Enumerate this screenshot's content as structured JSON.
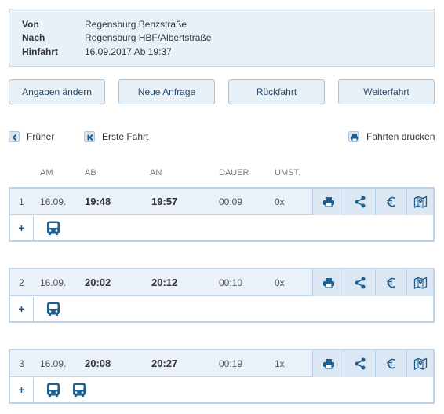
{
  "summary": {
    "from_label": "Von",
    "from_value": "Regensburg Benzstraße",
    "to_label": "Nach",
    "to_value": "Regensburg HBF/Albertstraße",
    "outbound_label": "Hinfahrt",
    "outbound_value": "16.09.2017 Ab 19:37"
  },
  "buttons": {
    "edit": "Angaben ändern",
    "new_query": "Neue Anfrage",
    "return": "Rückfahrt",
    "onward": "Weiterfahrt"
  },
  "nav": {
    "earlier": "Früher",
    "first": "Erste Fahrt",
    "print_all": "Fahrten drucken"
  },
  "columns": {
    "am": "AM",
    "ab": "AB",
    "an": "AN",
    "dauer": "DAUER",
    "umst": "UMST."
  },
  "trips": [
    {
      "num": "1",
      "date": "16.09.",
      "dep": "19:48",
      "arr": "19:57",
      "duration": "00:09",
      "transfers": "0x",
      "buses": 1
    },
    {
      "num": "2",
      "date": "16.09.",
      "dep": "20:02",
      "arr": "20:12",
      "duration": "00:10",
      "transfers": "0x",
      "buses": 1
    },
    {
      "num": "3",
      "date": "16.09.",
      "dep": "20:08",
      "arr": "20:27",
      "duration": "00:19",
      "transfers": "1x",
      "buses": 2
    }
  ],
  "expand_symbol": "+",
  "colors": {
    "accent": "#1f5f8f",
    "panel": "#e8f0f8",
    "border": "#c0d3e6"
  },
  "icons": [
    "chevron-left-icon",
    "skip-first-icon",
    "printer-icon",
    "share-icon",
    "euro-icon",
    "map-icon",
    "bus-icon"
  ]
}
